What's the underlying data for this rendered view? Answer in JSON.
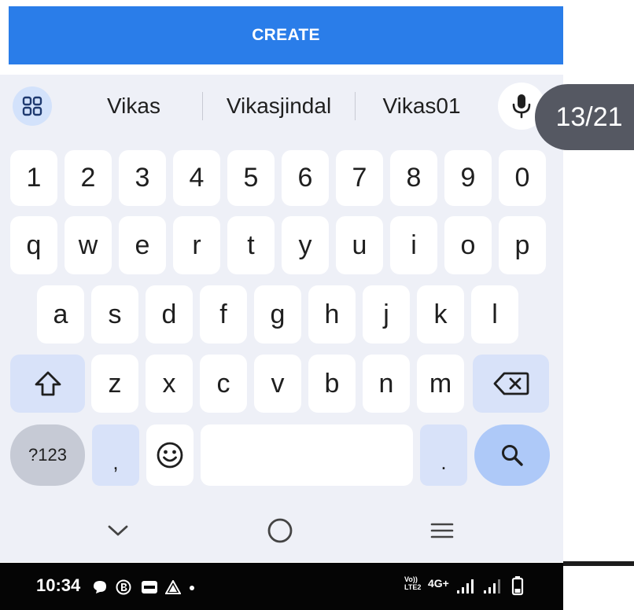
{
  "form": {
    "create_label": "CREATE"
  },
  "keyboard": {
    "suggestions": [
      "Vikas",
      "Vikasjindal",
      "Vikas01"
    ],
    "number_row": [
      "1",
      "2",
      "3",
      "4",
      "5",
      "6",
      "7",
      "8",
      "9",
      "0"
    ],
    "row1": [
      "q",
      "w",
      "e",
      "r",
      "t",
      "y",
      "u",
      "i",
      "o",
      "p"
    ],
    "row2": [
      "a",
      "s",
      "d",
      "f",
      "g",
      "h",
      "j",
      "k",
      "l"
    ],
    "row3": [
      "z",
      "x",
      "c",
      "v",
      "b",
      "n",
      "m"
    ],
    "symbols_label": "?123",
    "comma_label": ",",
    "period_label": ".",
    "icons": {
      "apps": "grid-icon",
      "mic": "microphone-icon",
      "shift": "shift-arrow-icon",
      "backspace": "backspace-icon",
      "emoji": "emoji-icon",
      "search": "search-icon"
    },
    "colors": {
      "background": "#eef0f7",
      "key": "#ffffff",
      "modifier": "#d8e2f9",
      "search": "#aec9f8"
    }
  },
  "navigation": {
    "icons": [
      "chevron-down-icon",
      "home-circle-icon",
      "menu-icon"
    ]
  },
  "overlay": {
    "counter": "13/21"
  },
  "status_bar": {
    "time": "10:34",
    "network": "4G+",
    "volte_line1": "Vo))",
    "volte_line2": "LTE2",
    "icons": [
      "chat-icon",
      "b-circle-icon",
      "paytm-icon",
      "triangle-app-icon",
      "dot-icon",
      "signal-1-icon",
      "signal-2-icon",
      "battery-icon"
    ]
  },
  "colors": {
    "accent": "#2a7de9",
    "counter_bg": "#555862",
    "status_bg": "#050505"
  }
}
